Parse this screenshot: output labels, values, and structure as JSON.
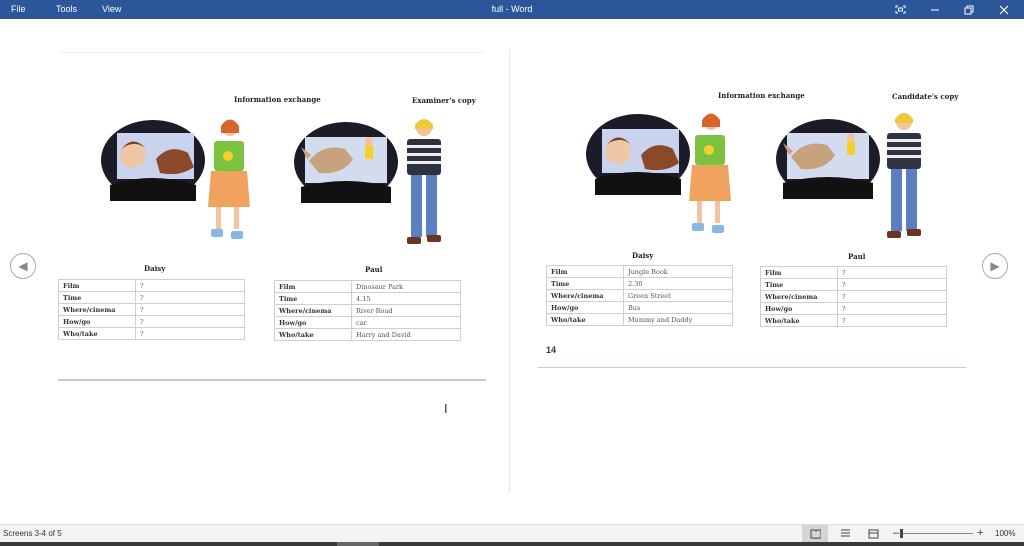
{
  "window": {
    "title": "full - Word",
    "menu": [
      "File",
      "Tools",
      "View"
    ],
    "controls": [
      "focus-icon",
      "minimize-icon",
      "restore-icon",
      "close-icon"
    ]
  },
  "left_page": {
    "heading": "Information exchange",
    "copy_label": "Examiner's copy",
    "daisy": {
      "name": "Daisy",
      "rows": [
        {
          "k": "Film",
          "v": "?"
        },
        {
          "k": "Time",
          "v": "?"
        },
        {
          "k": "Where/cinema",
          "v": "?"
        },
        {
          "k": "How/go",
          "v": "?"
        },
        {
          "k": "Who/take",
          "v": "?"
        }
      ]
    },
    "paul": {
      "name": "Paul",
      "rows": [
        {
          "k": "Film",
          "v": "Dinosaur Park"
        },
        {
          "k": "Time",
          "v": "4.15"
        },
        {
          "k": "Where/cinema",
          "v": "River Road"
        },
        {
          "k": "How/go",
          "v": "car"
        },
        {
          "k": "Who/take",
          "v": "Harry and David"
        }
      ]
    }
  },
  "right_page": {
    "heading": "Information exchange",
    "copy_label": "Candidate's copy",
    "page_mark": "14",
    "daisy": {
      "name": "Daisy",
      "rows": [
        {
          "k": "Film",
          "v": "Jungle Book"
        },
        {
          "k": "Time",
          "v": "2.30"
        },
        {
          "k": "Where/cinema",
          "v": "Green Street"
        },
        {
          "k": "How/go",
          "v": "Bus"
        },
        {
          "k": "Who/take",
          "v": "Mummy and Daddy"
        }
      ]
    },
    "paul": {
      "name": "Paul",
      "rows": [
        {
          "k": "Film",
          "v": "?"
        },
        {
          "k": "Time",
          "v": "?"
        },
        {
          "k": "Where/cinema",
          "v": "?"
        },
        {
          "k": "How/go",
          "v": "?"
        },
        {
          "k": "Who/take",
          "v": "?"
        }
      ]
    }
  },
  "status": {
    "screens": "Screens 3-4 of 5",
    "zoom": "100%",
    "zoom_level": 1.0
  },
  "colors": {
    "titlebar": "#2b579a",
    "girl_shirt": "#7cc241",
    "girl_skirt": "#f0a35e",
    "boy_jeans": "#5b7fc1"
  }
}
